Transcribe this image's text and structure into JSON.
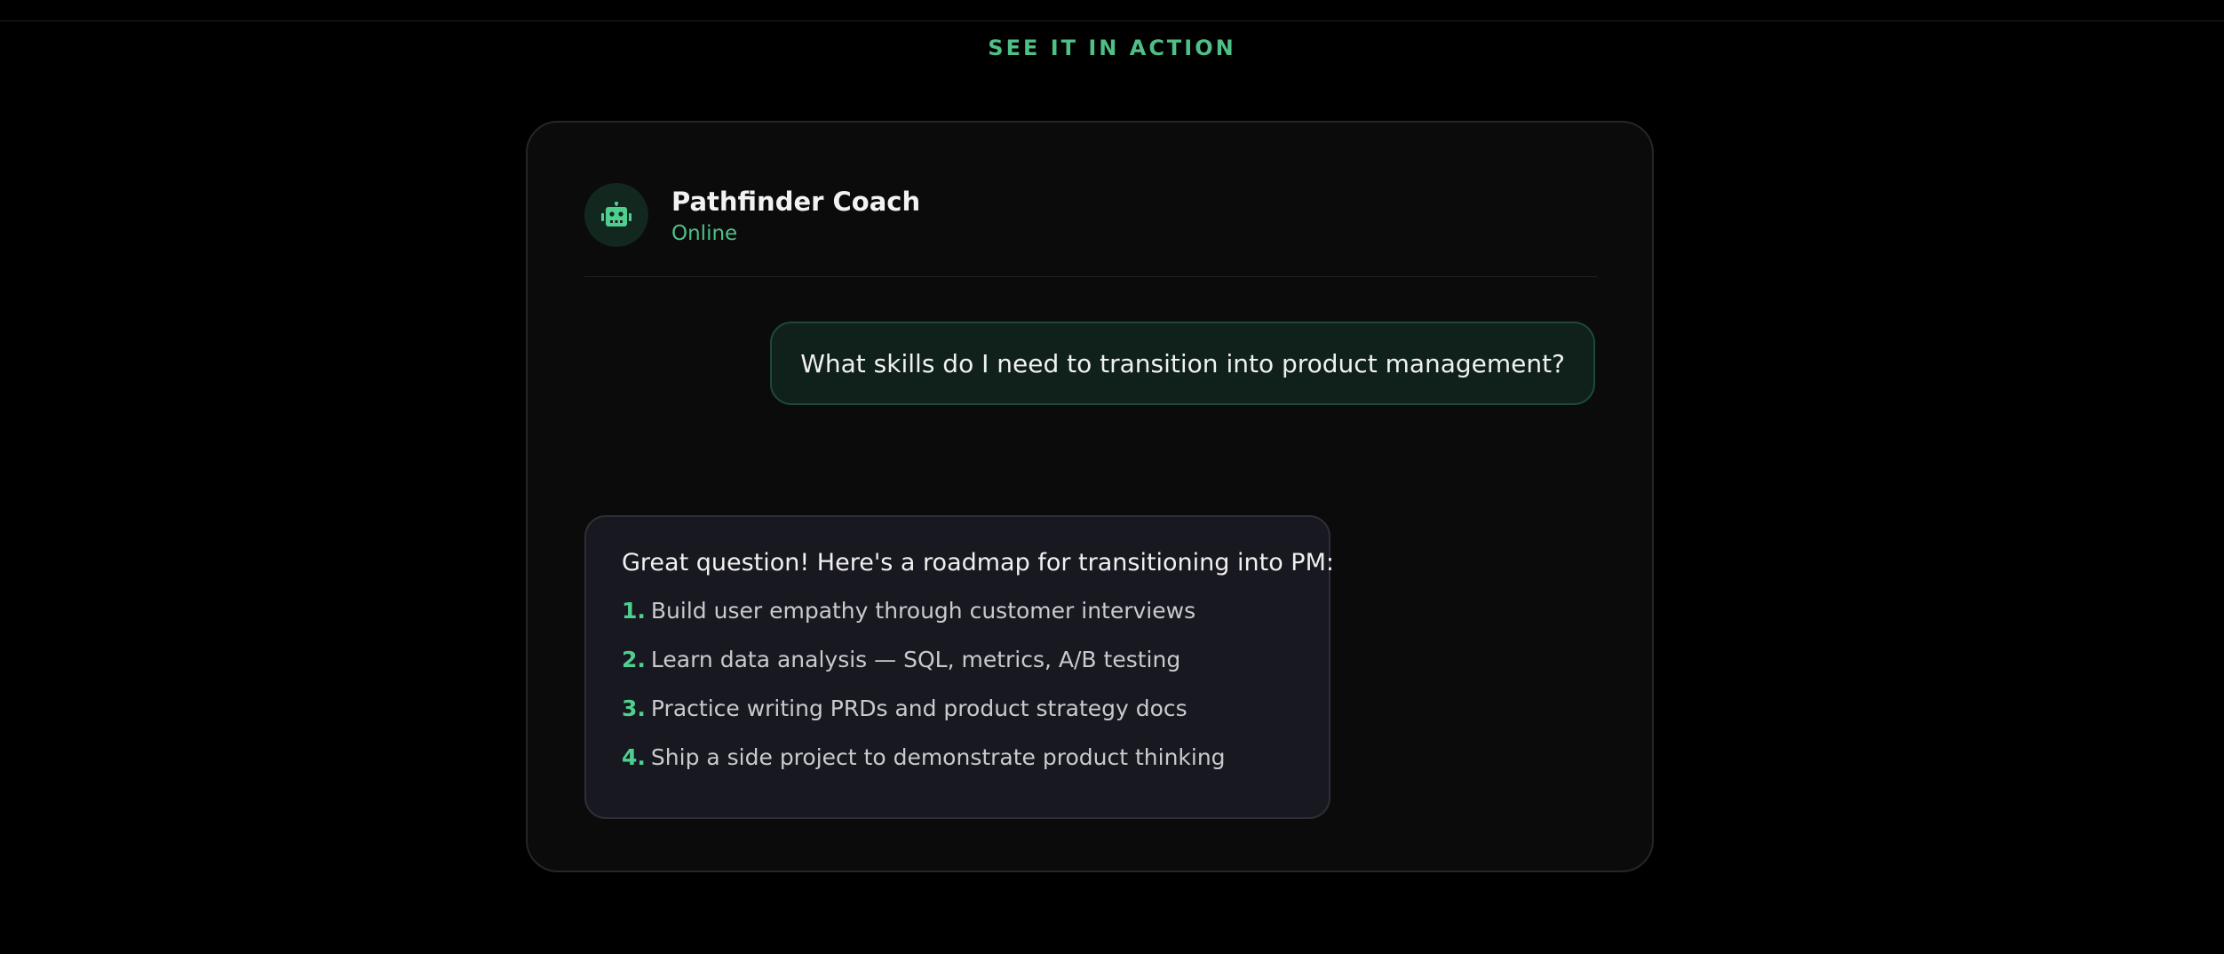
{
  "section": {
    "eyebrow": "SEE IT IN ACTION"
  },
  "chat": {
    "bot_name": "Pathfinder Coach",
    "status": "Online",
    "avatar_icon": "robot-icon",
    "user_message": "What skills do I need to transition into product management?",
    "bot_reply": {
      "intro": "Great question! Here's a roadmap for transitioning into PM:",
      "steps": [
        {
          "num": "1.",
          "text": "Build user empathy through customer interviews"
        },
        {
          "num": "2.",
          "text": "Learn data analysis — SQL, metrics, A/B testing"
        },
        {
          "num": "3.",
          "text": "Practice writing PRDs and product strategy docs"
        },
        {
          "num": "4.",
          "text": "Ship a side project to demonstrate product thinking"
        }
      ]
    }
  },
  "colors": {
    "background": "#000000",
    "card": "#0b0b0b",
    "accent_green": "#4fbf87",
    "user_bubble": "#0f211a",
    "bot_bubble": "#181820"
  }
}
